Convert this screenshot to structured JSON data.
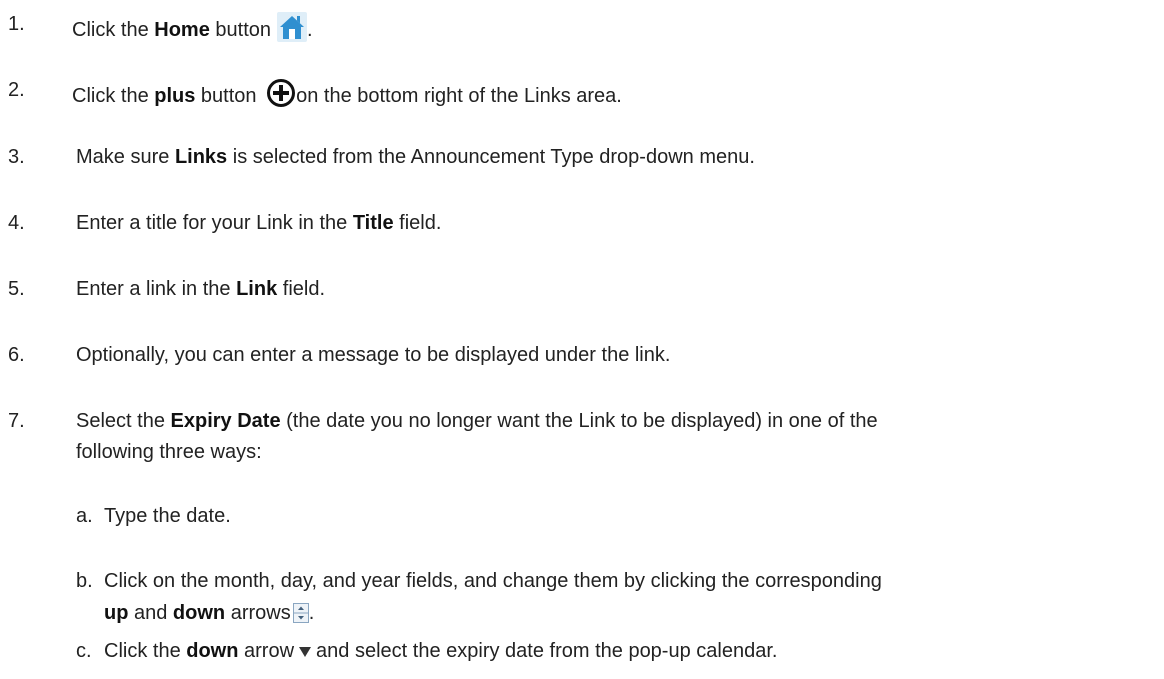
{
  "steps": [
    {
      "num": "1.",
      "before": "Click the ",
      "bold": "Home",
      "after": " button",
      "after_icon": "."
    },
    {
      "num": "2.",
      "before": "Click the ",
      "bold": "plus",
      "mid": " button ",
      "after": "on the bottom right of the Links area."
    },
    {
      "num": "3.",
      "before": "Make sure ",
      "bold": "Links",
      "after": " is selected from the Announcement Type drop-down menu."
    },
    {
      "num": "4.",
      "before": "Enter a title for your Link in the ",
      "bold": "Title",
      "after": " field."
    },
    {
      "num": "5.",
      "before": "Enter a link in the ",
      "bold": "Link",
      "after": " field."
    },
    {
      "num": "6.",
      "text": "Optionally, you can enter a message to be displayed under the link."
    },
    {
      "num": "7.",
      "before": "Select the ",
      "bold": "Expiry Date",
      "after": " (the date you no longer want the Link to be displayed) in one of the",
      "line2": "following three ways:"
    }
  ],
  "substeps": [
    {
      "letter": "a.",
      "text": "Type the date."
    },
    {
      "letter": "b.",
      "line1": "Click on the month, day, and year fields, and change them by clicking the corresponding",
      "bold1": "up",
      "mid": " and ",
      "bold2": "down",
      "after": " arrows",
      "after_icon": "."
    },
    {
      "letter": "c.",
      "before": "Click the ",
      "bold": "down",
      "mid": " arrow",
      "after": "and select the expiry date from the pop-up calendar."
    }
  ],
  "icons": {
    "home": "home-icon",
    "plus": "plus-circle-icon",
    "updown": "up-down-arrows-icon",
    "down": "down-triangle-icon",
    "home_color": "#2f8fd0",
    "plus_color": "#111111"
  }
}
